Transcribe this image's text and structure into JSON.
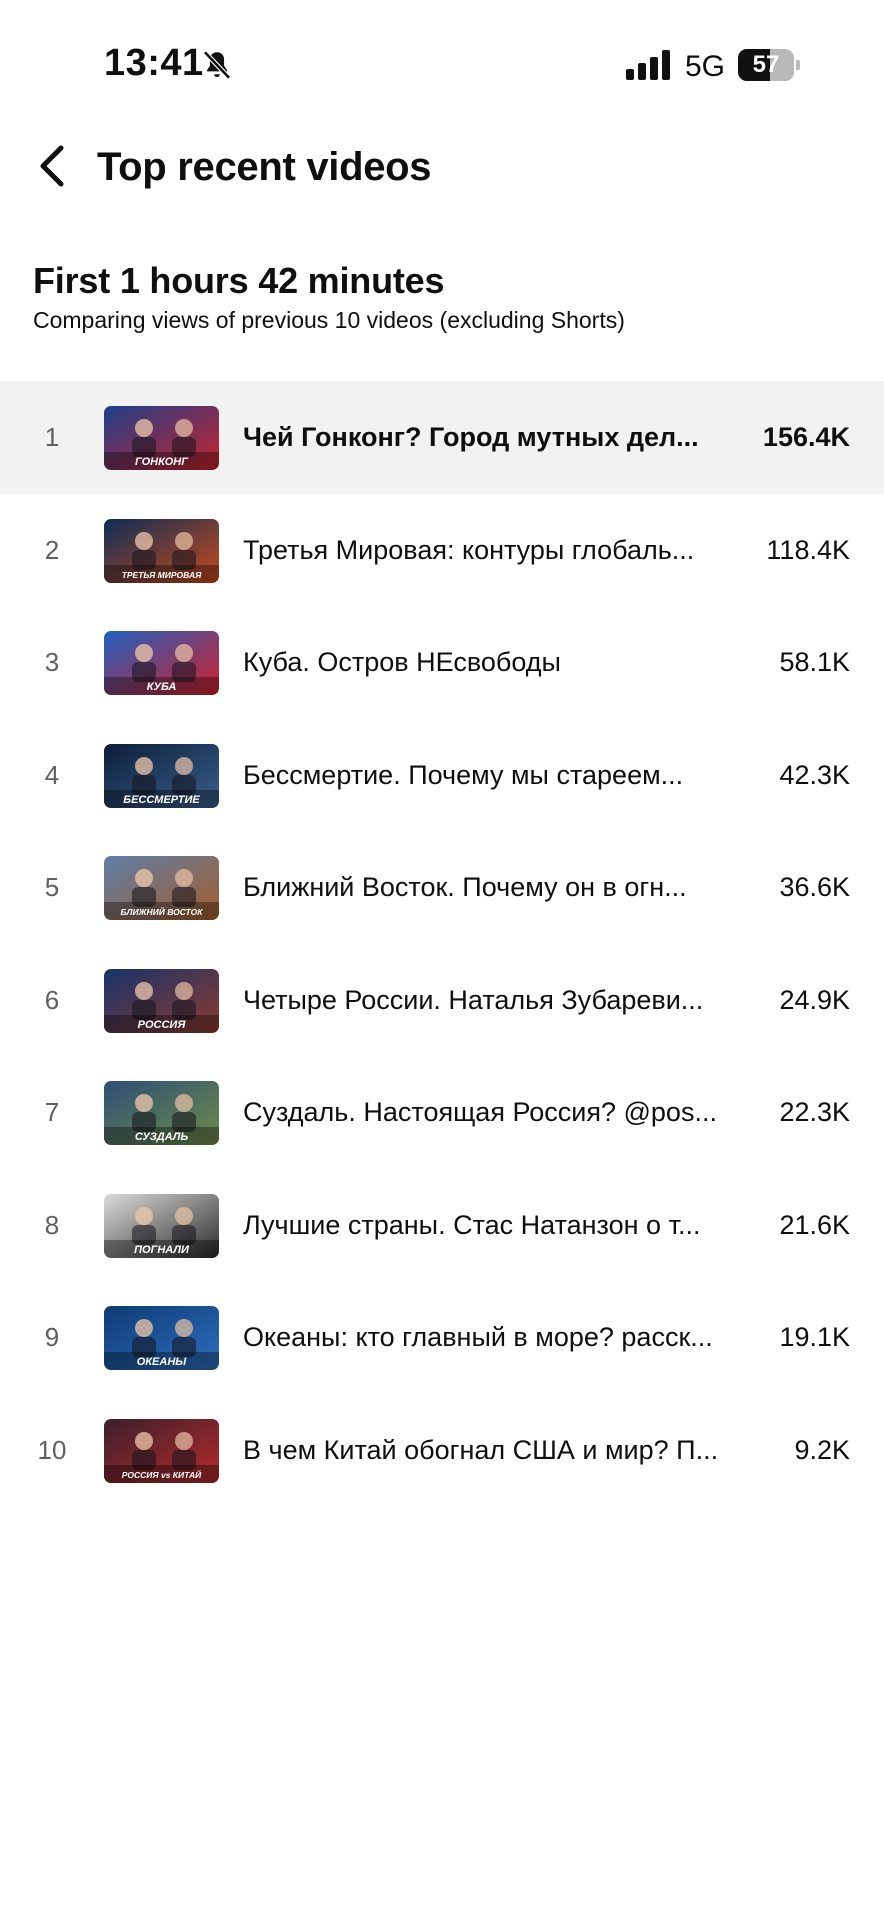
{
  "status_bar": {
    "time": "13:41",
    "network": "5G",
    "battery_percent": 57,
    "battery_label": "57",
    "icons": [
      "bell-off-icon",
      "cellular-signal-icon",
      "battery-icon"
    ]
  },
  "header": {
    "title": "Top recent videos",
    "back_icon": "chevron-left-icon"
  },
  "section": {
    "title": "First 1 hours 42 minutes",
    "subtitle": "Comparing views of previous 10 videos (excluding Shorts)"
  },
  "videos": [
    {
      "rank": "1",
      "title": "Чей Гонконг? Город мутных дел...",
      "views": "156.4K",
      "thumb_label": "ГОНКОНГ",
      "thumb_colors": [
        "#1d3f8a",
        "#c8232c"
      ]
    },
    {
      "rank": "2",
      "title": "Третья Мировая: контуры глобаль...",
      "views": "118.4K",
      "thumb_label": "ТРЕТЬЯ МИРОВАЯ",
      "thumb_colors": [
        "#0d2d55",
        "#c84a1e"
      ]
    },
    {
      "rank": "3",
      "title": "Куба. Остров НЕсвободы",
      "views": "58.1K",
      "thumb_label": "КУБА",
      "thumb_colors": [
        "#1f5fbf",
        "#d3202a"
      ]
    },
    {
      "rank": "4",
      "title": "Бессмертие. Почему мы стареем...",
      "views": "42.3K",
      "thumb_label": "БЕССМЕРТИЕ",
      "thumb_colors": [
        "#0c1e3a",
        "#3a5f8c"
      ]
    },
    {
      "rank": "5",
      "title": "Ближний Восток. Почему он в огн...",
      "views": "36.6K",
      "thumb_label": "БЛИЖНИЙ ВОСТОК",
      "thumb_colors": [
        "#5e7ea8",
        "#a35d2b"
      ]
    },
    {
      "rank": "6",
      "title": "Четыре России. Наталья Зубареви...",
      "views": "24.9K",
      "thumb_label": "РОССИЯ",
      "thumb_colors": [
        "#17336b",
        "#8c3a2f"
      ]
    },
    {
      "rank": "7",
      "title": "Суздаль. Настоящая Россия? @pos...",
      "views": "22.3K",
      "thumb_label": "СУЗДАЛЬ",
      "thumb_colors": [
        "#2d4f76",
        "#6e8b4a"
      ]
    },
    {
      "rank": "8",
      "title": "Лучшие страны. Стас Натанзон о т...",
      "views": "21.6K",
      "thumb_label": "ПОГНАЛИ",
      "thumb_colors": [
        "#dcdcdc",
        "#2a2a2a"
      ]
    },
    {
      "rank": "9",
      "title": "Океаны: кто главный в море? расск...",
      "views": "19.1K",
      "thumb_label": "ОКЕАНЫ",
      "thumb_colors": [
        "#0d3b73",
        "#2e6fbf"
      ]
    },
    {
      "rank": "10",
      "title": "В чем Китай обогнал США и мир? П...",
      "views": "9.2K",
      "thumb_label": "РОССИЯ vs КИТАЙ",
      "thumb_colors": [
        "#3b1f2c",
        "#b52a2a"
      ]
    }
  ]
}
